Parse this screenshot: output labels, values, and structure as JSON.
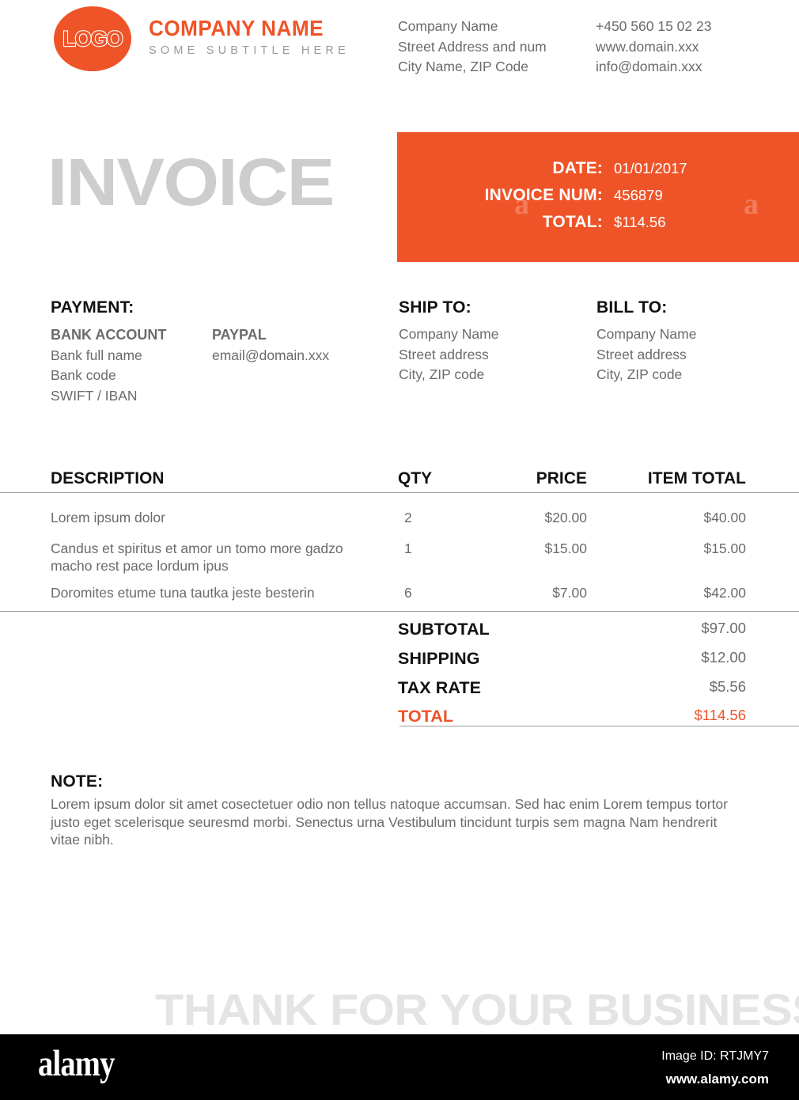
{
  "header": {
    "logo_text": "LOGO",
    "company_name": "COMPANY NAME",
    "company_subtitle": "SOME SUBTITLE HERE",
    "contact_left": [
      "Company Name",
      "Street Address and num",
      "City Name, ZIP Code"
    ],
    "contact_right": [
      "+450 560 15 02 23",
      "www.domain.xxx",
      "info@domain.xxx"
    ]
  },
  "title": {
    "invoice_word": "INVOICE"
  },
  "meta": {
    "date_label": "DATE:",
    "date_value": "01/01/2017",
    "invoice_num_label": "INVOICE NUM:",
    "invoice_num_value": "456879",
    "total_label": "TOTAL:",
    "total_value": "$114.56",
    "watermark_letter": "a"
  },
  "payment": {
    "title": "PAYMENT:",
    "bank_heading": "BANK ACCOUNT",
    "bank_lines": [
      "Bank full name",
      "Bank code",
      "SWIFT / IBAN"
    ],
    "paypal_heading": "PAYPAL",
    "paypal_lines": [
      "email@domain.xxx"
    ]
  },
  "ship_to": {
    "title": "SHIP TO:",
    "lines": [
      "Company Name",
      "Street address",
      "City, ZIP code"
    ]
  },
  "bill_to": {
    "title": "BILL TO:",
    "lines": [
      "Company Name",
      "Street address",
      "City, ZIP code"
    ]
  },
  "table": {
    "headers": {
      "description": "DESCRIPTION",
      "qty": "QTY",
      "price": "PRICE",
      "item_total": "ITEM TOTAL"
    },
    "rows": [
      {
        "description": "Lorem ipsum dolor",
        "qty": "2",
        "price": "$20.00",
        "item_total": "$40.00"
      },
      {
        "description": "Candus et spiritus et amor un tomo more gadzo macho rest pace lordum ipus",
        "qty": "1",
        "price": "$15.00",
        "item_total": "$15.00"
      },
      {
        "description": "Doromites etume tuna tautka jeste besterin",
        "qty": "6",
        "price": "$7.00",
        "item_total": "$42.00"
      }
    ]
  },
  "totals": [
    {
      "label": "SUBTOTAL",
      "value": "$97.00"
    },
    {
      "label": "SHIPPING",
      "value": "$12.00"
    },
    {
      "label": "TAX RATE",
      "value": "$5.56"
    },
    {
      "label": "TOTAL",
      "value": "$114.56"
    }
  ],
  "note": {
    "title": "NOTE:",
    "text": "Lorem ipsum dolor sit amet cosectetuer odio non tellus natoque accumsan. Sed hac enim Lorem tempus tortor justo eget scelerisque seuresmd morbi. Senectus urna Vestibulum tincidunt turpis sem magna Nam hendrerit vitae nibh."
  },
  "footer_message": {
    "text": "THANK FOR YOUR BUSINESS"
  },
  "stock_footer": {
    "logo": "alamy",
    "image_id": "Image ID: RTJMY7",
    "url": "www.alamy.com"
  },
  "colors": {
    "accent_orange": "#ee5428",
    "title_gray": "#cdcdcd",
    "body_gray": "#6b6b6b",
    "rule_gray": "#9b9b9b",
    "footer_black": "#000000"
  }
}
